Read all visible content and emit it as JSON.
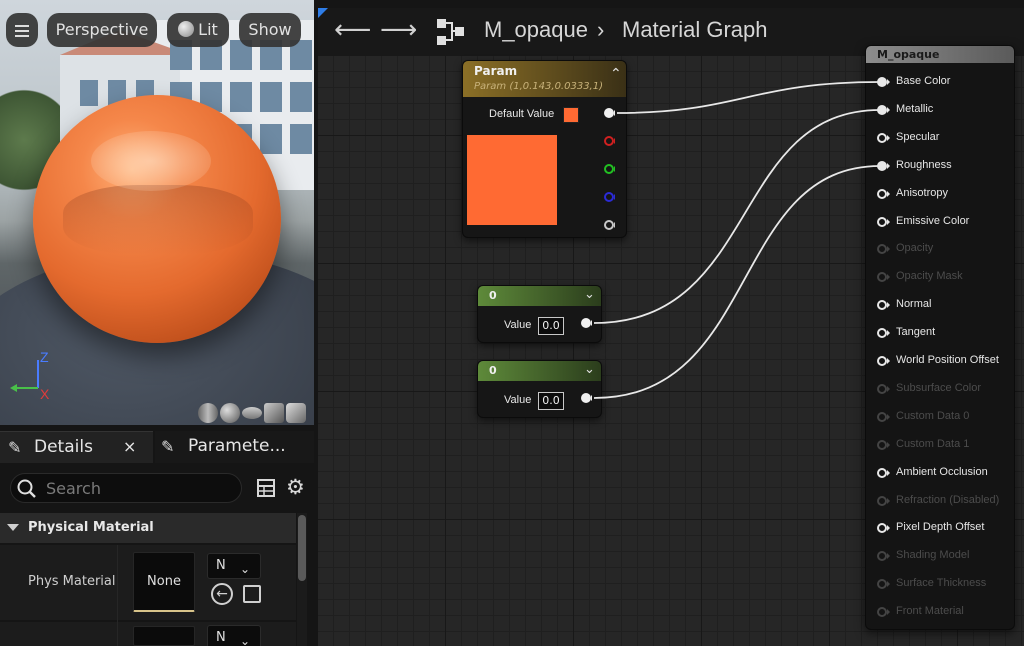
{
  "viewport": {
    "perspective_label": "Perspective",
    "lit_label": "Lit",
    "show_label": "Show",
    "axis_z": "Z",
    "axis_x": "X"
  },
  "details_panel": {
    "details_tab": "Details",
    "details_close": "×",
    "parameters_tab": "Paramete...",
    "search_placeholder": "Search",
    "section_title": "Physical Material",
    "phys_material_label": "Phys Material",
    "phys_material_value": "None",
    "combo_value": "N",
    "combo_value_2": "N"
  },
  "graph": {
    "asset_name": "M_opaque",
    "graph_title": "Material Graph",
    "param_node": {
      "title": "Param",
      "subtitle": "Param (1,0.143,0.0333,1)",
      "default_value_label": "Default Value",
      "color": "#ff6a33"
    },
    "constant_nodes": [
      {
        "title": "0",
        "value_label": "Value",
        "value": "0.0"
      },
      {
        "title": "0",
        "value_label": "Value",
        "value": "0.0"
      }
    ],
    "material_node": {
      "title": "M_opaque",
      "inputs": [
        {
          "label": "Base Color",
          "enabled": true,
          "connected": true
        },
        {
          "label": "Metallic",
          "enabled": true,
          "connected": true
        },
        {
          "label": "Specular",
          "enabled": true,
          "connected": false
        },
        {
          "label": "Roughness",
          "enabled": true,
          "connected": true
        },
        {
          "label": "Anisotropy",
          "enabled": true,
          "connected": false
        },
        {
          "label": "Emissive Color",
          "enabled": true,
          "connected": false
        },
        {
          "label": "Opacity",
          "enabled": false,
          "connected": false
        },
        {
          "label": "Opacity Mask",
          "enabled": false,
          "connected": false
        },
        {
          "label": "Normal",
          "enabled": true,
          "connected": false
        },
        {
          "label": "Tangent",
          "enabled": true,
          "connected": false
        },
        {
          "label": "World Position Offset",
          "enabled": true,
          "connected": false
        },
        {
          "label": "Subsurface Color",
          "enabled": false,
          "connected": false
        },
        {
          "label": "Custom Data 0",
          "enabled": false,
          "connected": false
        },
        {
          "label": "Custom Data 1",
          "enabled": false,
          "connected": false
        },
        {
          "label": "Ambient Occlusion",
          "enabled": true,
          "connected": false
        },
        {
          "label": "Refraction (Disabled)",
          "enabled": false,
          "connected": false
        },
        {
          "label": "Pixel Depth Offset",
          "enabled": true,
          "connected": false
        },
        {
          "label": "Shading Model",
          "enabled": false,
          "connected": false
        },
        {
          "label": "Surface Thickness",
          "enabled": false,
          "connected": false
        },
        {
          "label": "Front Material",
          "enabled": false,
          "connected": false
        }
      ]
    }
  }
}
